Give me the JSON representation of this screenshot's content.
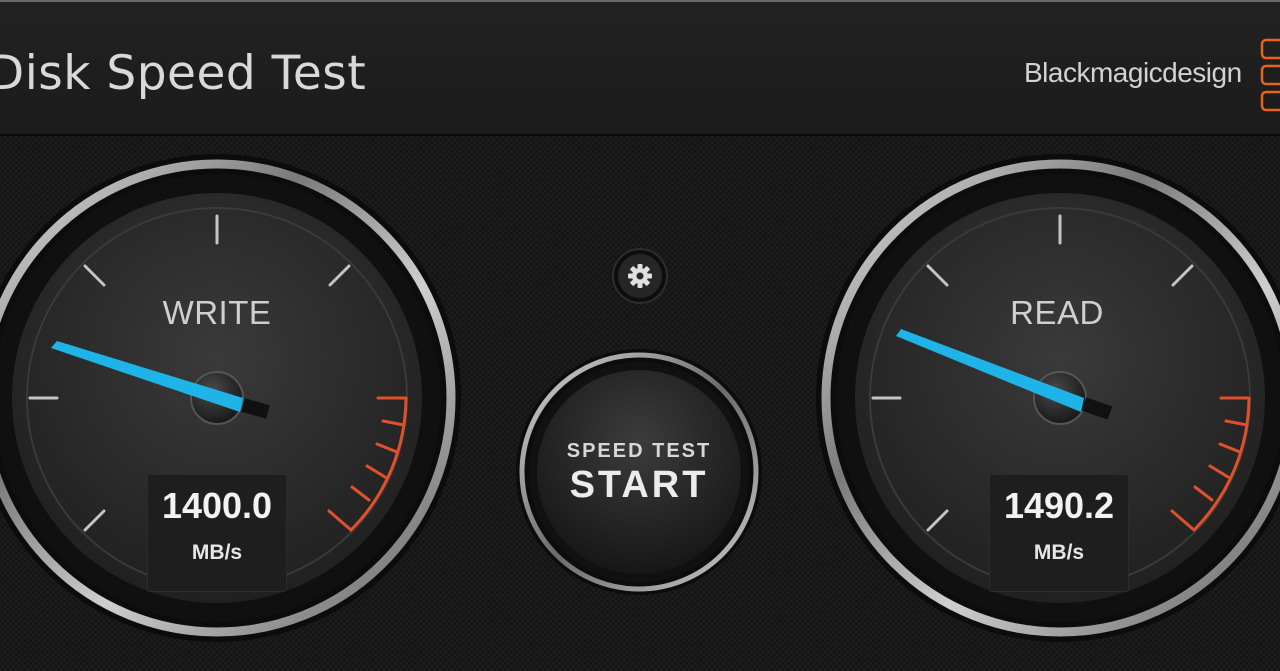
{
  "app": {
    "title": "Disk Speed Test",
    "brand": "Blackmagicdesign"
  },
  "write_gauge": {
    "label": "WRITE",
    "value": "1400.0",
    "unit": "MB/s"
  },
  "read_gauge": {
    "label": "READ",
    "value": "1490.2",
    "unit": "MB/s"
  },
  "start_button": {
    "subtitle": "SPEED TEST",
    "label": "START"
  },
  "icons": {
    "settings": "gear-icon",
    "brand_logo": "blackmagic-logo-icon"
  },
  "colors": {
    "needle": "#1fb4e8",
    "redline": "#e0512b",
    "brand_logo": "#e8641e"
  }
}
